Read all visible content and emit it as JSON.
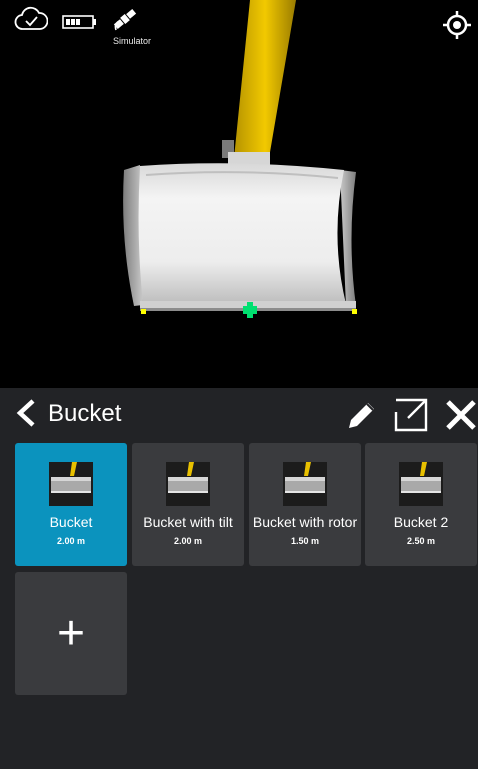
{
  "status": {
    "cloud_icon": "cloud-check-icon",
    "battery_icon": "battery-icon",
    "gnss_icon": "satellite-icon",
    "gnss_label": "Simulator",
    "locate_icon": "locate-target-icon"
  },
  "panel": {
    "title": "Bucket",
    "back_icon": "chevron-left-icon",
    "edit_icon": "pencil-icon",
    "open_icon": "external-open-icon",
    "close_icon": "close-icon"
  },
  "buckets": [
    {
      "name": "Bucket",
      "width": "2.00 m",
      "selected": true
    },
    {
      "name": "Bucket with tilt",
      "width": "2.00 m",
      "selected": false
    },
    {
      "name": "Bucket with rotor",
      "width": "1.50 m",
      "selected": false
    },
    {
      "name": "Bucket 2",
      "width": "2.50 m",
      "selected": false
    }
  ],
  "add_label": "+",
  "colors": {
    "selected_tile": "#0b93be",
    "tile": "#3a3b3e",
    "panel": "#222326",
    "arm": "#e8c000"
  }
}
